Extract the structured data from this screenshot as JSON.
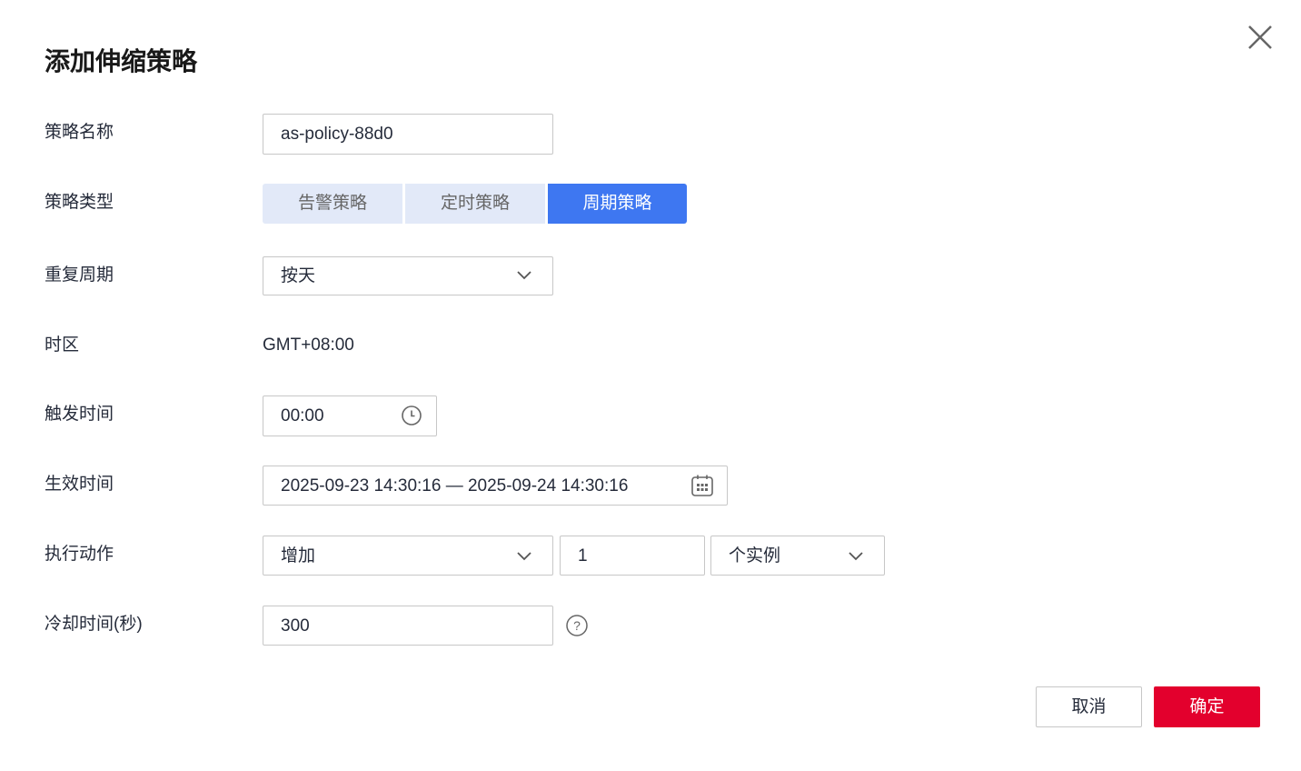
{
  "dialog": {
    "title": "添加伸缩策略",
    "close_icon": "close-icon"
  },
  "form": {
    "name": {
      "label": "策略名称",
      "value": "as-policy-88d0"
    },
    "type": {
      "label": "策略类型",
      "options": [
        "告警策略",
        "定时策略",
        "周期策略"
      ],
      "selected": "周期策略"
    },
    "repeat": {
      "label": "重复周期",
      "value": "按天"
    },
    "timezone": {
      "label": "时区",
      "value": "GMT+08:00"
    },
    "trigger_time": {
      "label": "触发时间",
      "value": "00:00"
    },
    "effective_time": {
      "label": "生效时间",
      "value": "2025-09-23 14:30:16 — 2025-09-24 14:30:16"
    },
    "action": {
      "label": "执行动作",
      "operation": "增加",
      "count": "1",
      "unit": "个实例"
    },
    "cooldown": {
      "label": "冷却时间(秒)",
      "value": "300"
    }
  },
  "footer": {
    "cancel": "取消",
    "confirm": "确定"
  },
  "colors": {
    "primary": "#3e77f1",
    "danger": "#e3002d",
    "segment_off": "#e2e9f8"
  }
}
